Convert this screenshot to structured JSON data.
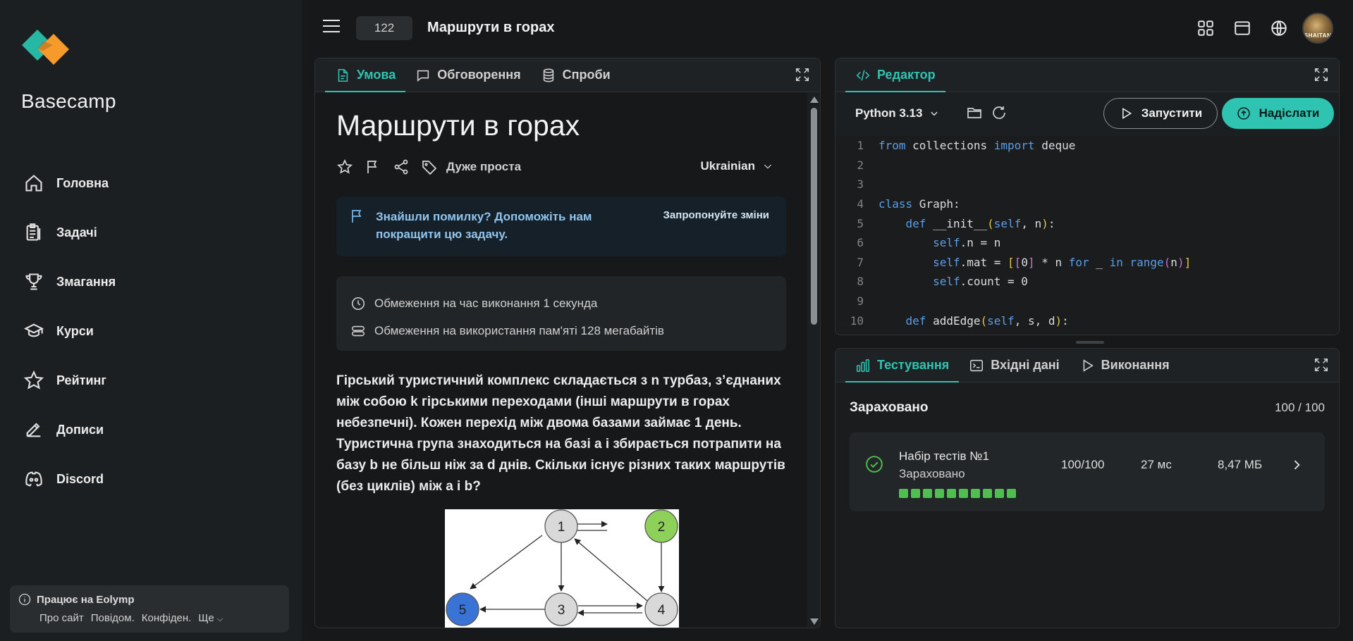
{
  "sidebar": {
    "brand": "Basecamp",
    "nav": [
      {
        "label": "Головна",
        "icon": "home-icon"
      },
      {
        "label": "Задачі",
        "icon": "clipboard-icon"
      },
      {
        "label": "Змагання",
        "icon": "trophy-icon"
      },
      {
        "label": "Курси",
        "icon": "graduation-cap-icon"
      },
      {
        "label": "Рейтинг",
        "icon": "star-icon"
      },
      {
        "label": "Дописи",
        "icon": "edit-icon"
      },
      {
        "label": "Discord",
        "icon": "discord-icon"
      }
    ],
    "footer": {
      "powered": "Працює на Eolymp",
      "links": [
        "Про сайт",
        "Повідом.",
        "Конфіден.",
        "Ще"
      ]
    }
  },
  "topbar": {
    "problem_id": "122",
    "problem_title": "Маршрути в горах",
    "avatar_text": "SHAITAN"
  },
  "problem_panel": {
    "tabs": [
      "Умова",
      "Обговорення",
      "Спроби"
    ],
    "title": "Маршрути в горах",
    "difficulty": "Дуже проста",
    "language": "Ukrainian",
    "info": {
      "text": "Знайшли помилку? Допоможіть нам покращити цю задачу.",
      "link": "Запропонуйте зміни"
    },
    "limits": {
      "time": "Обмеження на час виконання 1 секунда",
      "memory": "Обмеження на використання пам'яті 128 мегабайтів"
    },
    "statement_parts": [
      "Гірський туристичний комплекс складається з ",
      "n",
      " турбаз, з’єднаних між собою ",
      "k",
      " гірськими переходами (інші маршрути в горах небезпечні). Кожен перехід між двома базами займає ",
      "1",
      " день. Туристична група знаходиться на базі ",
      "a",
      " і збирається потрапити на базу ",
      "b",
      " не більш ніж за ",
      "d",
      " днів. Скільки існує різних таких маршрутів (без циклів) між ",
      "a",
      " і ",
      "b",
      "?"
    ],
    "graph_nodes": [
      "1",
      "2",
      "3",
      "4",
      "5"
    ]
  },
  "editor_panel": {
    "tab": "Редактор",
    "language": "Python 3.13",
    "run_label": "Запустити",
    "submit_label": "Надіслати",
    "colors": {
      "accent": "#2fc4b2"
    },
    "line_numbers": [
      "1",
      "2",
      "3",
      "4",
      "5",
      "6",
      "7",
      "8",
      "9",
      "10"
    ],
    "code_lines": [
      "from collections import deque",
      "",
      "",
      "class Graph:",
      "    def __init__(self, n):",
      "        self.n = n",
      "        self.mat = [[0] * n for _ in range(n)]",
      "        self.count = 0",
      "",
      "    def addEdge(self, s, d):"
    ]
  },
  "testing_panel": {
    "tabs": [
      "Тестування",
      "Вхідні дані",
      "Виконання"
    ],
    "status": "Зараховано",
    "score": "100 / 100",
    "test_set": {
      "name": "Набір тестів №1",
      "status": "Зараховано",
      "score": "100/100",
      "time": "27 мс",
      "memory": "8,47 МБ",
      "passed_count": 10
    }
  }
}
